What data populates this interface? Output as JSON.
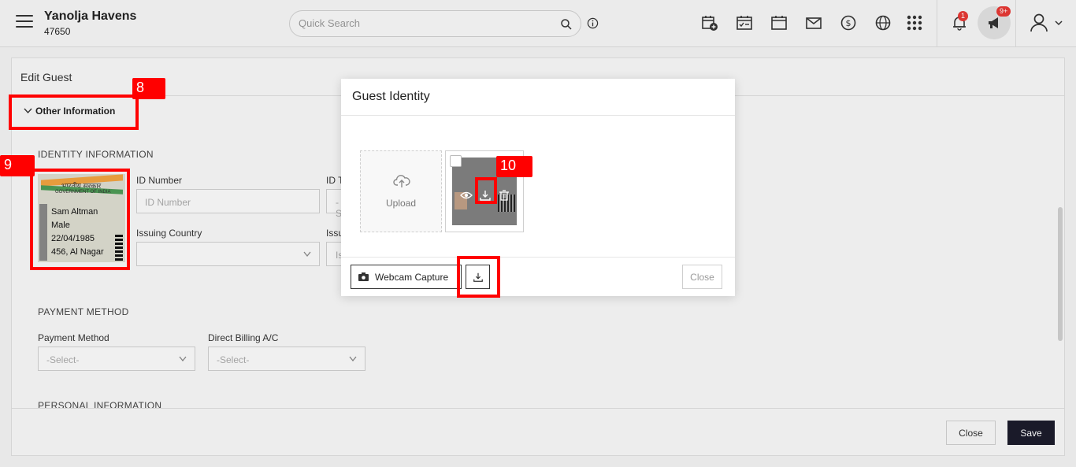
{
  "header": {
    "hotel_name": "Yanolja Havens",
    "hotel_id": "47650",
    "search_placeholder": "Quick Search",
    "notification_count": "1",
    "announcement_count": "9+"
  },
  "form": {
    "title": "Edit Guest",
    "other_info_label": "Other Information",
    "identity_section": "IDENTITY INFORMATION",
    "id_card": {
      "hindi": "भारतीय सरकार",
      "gov": "GOVERNMENT OF INDIA",
      "name": "Sam Altman",
      "gender": "Male",
      "dob": "22/04/1985",
      "address": "456, Al Nagar"
    },
    "id_number_label": "ID Number",
    "id_number_placeholder": "ID Number",
    "id_type_label": "ID T",
    "id_type_value": "-S",
    "issuing_country_label": "Issuing Country",
    "issuing_label2": "Issu",
    "issuing_value2": "Is",
    "payment_section": "PAYMENT METHOD",
    "payment_method_label": "Payment Method",
    "payment_method_value": "-Select-",
    "direct_billing_label": "Direct Billing A/C",
    "direct_billing_value": "-Select-",
    "personal_section": "PERSONAL INFORMATION",
    "close_label": "Close",
    "save_label": "Save"
  },
  "modal": {
    "title": "Guest Identity",
    "upload_label": "Upload",
    "webcam_label": "Webcam Capture",
    "close_label": "Close"
  },
  "annotations": {
    "a8": "8",
    "a9": "9",
    "a10": "10",
    "color": "#ff0000"
  }
}
